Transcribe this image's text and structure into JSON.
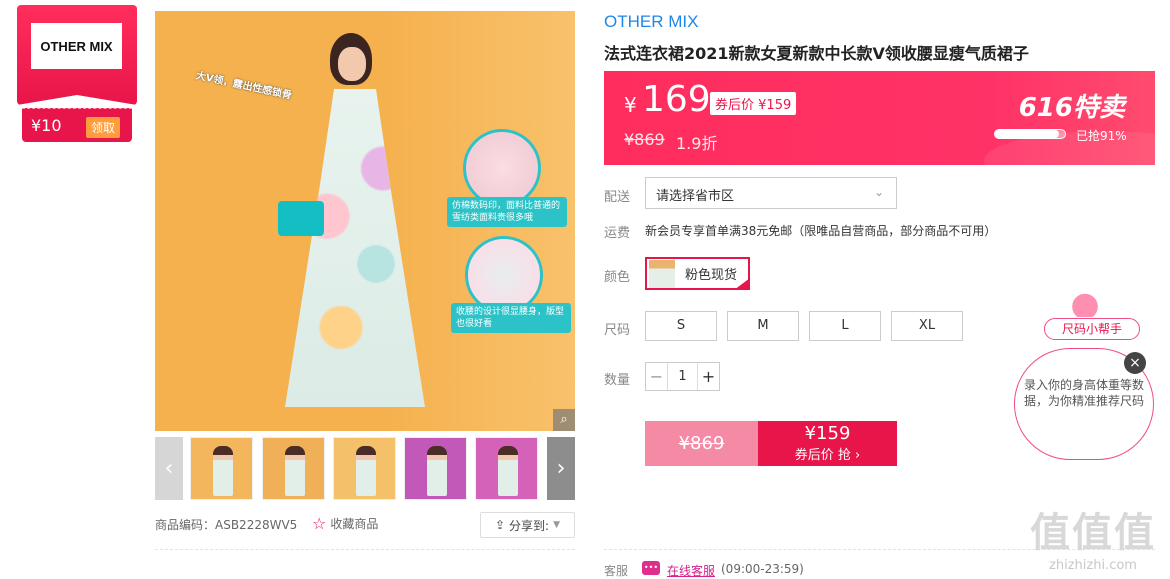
{
  "brand_badge": {
    "logo_text": "OTHER MIX",
    "coupon_amount": "¥10",
    "coupon_claim": "领取"
  },
  "main_image": {
    "caption_1": "大V领，露出性感锁骨",
    "caption_2": "仿棉数码印，面料比普通的雪纺类面料贵很多哦",
    "caption_3": "收腰的设计很显腰身，版型也很好看"
  },
  "thumbnails": {
    "prev_icon": "‹",
    "next_icon": "›",
    "count": 5
  },
  "product_meta": {
    "code_label": "商品编码：ASB2228WV5",
    "favorite_label": "收藏商品",
    "share_label": "分享到:"
  },
  "product": {
    "brand": "OTHER MIX",
    "title": "法式连衣裙2021新款女夏新款中长款V领收腰显瘦气质裙子"
  },
  "price_banner": {
    "currency": "¥",
    "price": "169",
    "coupon_label": "券后价",
    "coupon_price": "¥159",
    "original_price": "¥869",
    "discount": "1.9折",
    "sale_tag_num": "616",
    "sale_tag_text": "特卖",
    "sold_percent": 0.91,
    "sold_text": "已抢91%"
  },
  "delivery": {
    "label": "配送",
    "placeholder": "请选择省市区"
  },
  "shipping": {
    "label": "运费",
    "text": "新会员专享首单满38元免邮（限唯品自营商品，部分商品不可用）"
  },
  "color": {
    "label": "颜色",
    "options": [
      {
        "name": "粉色现货",
        "selected": true
      }
    ]
  },
  "size": {
    "label": "尺码",
    "options": [
      "S",
      "M",
      "L",
      "XL"
    ]
  },
  "quantity": {
    "label": "数量",
    "value": "1",
    "minus": "−",
    "plus": "+"
  },
  "buy": {
    "original_price": "¥869",
    "coupon_price": "¥159",
    "action": "券后价 抢 ›"
  },
  "service": {
    "label": "客服",
    "link": "在线客服",
    "hours": "(09:00-23:59)"
  },
  "size_helper": {
    "title": "尺码小帮手",
    "message": "录入你的身高体重等数据，为你精准推荐尺码",
    "close": "×"
  },
  "watermark": {
    "big": "值值值",
    "small": "zhizhizhi.com"
  },
  "colors": {
    "accent": "#e8154a",
    "brand_blue": "#1f87e6",
    "service_pink": "#d2218b"
  }
}
